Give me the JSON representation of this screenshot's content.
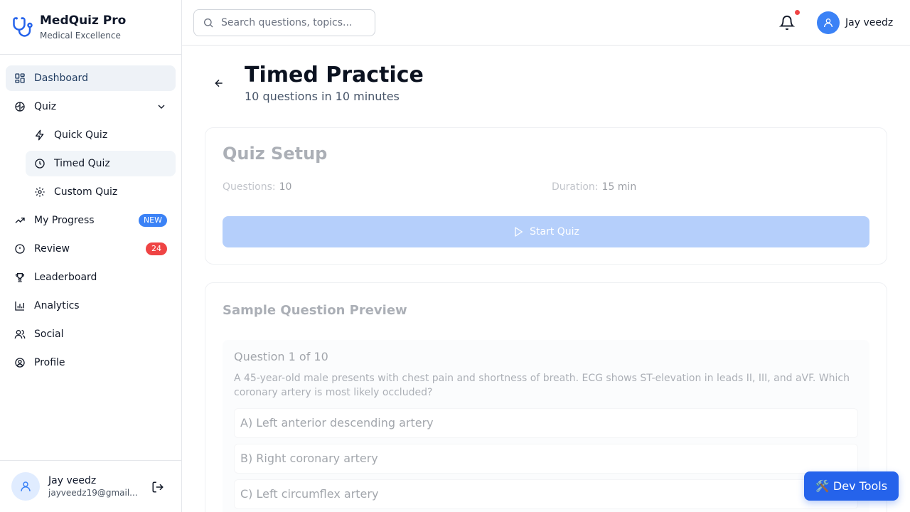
{
  "brand": {
    "title": "MedQuiz Pro",
    "subtitle": "Medical Excellence"
  },
  "sidebar": {
    "items": [
      {
        "label": "Dashboard",
        "icon": "dashboard-icon"
      },
      {
        "label": "Quiz",
        "icon": "brain-icon"
      },
      {
        "label": "Quick Quiz",
        "icon": "zap-icon"
      },
      {
        "label": "Timed Quiz",
        "icon": "clock-icon"
      },
      {
        "label": "Custom Quiz",
        "icon": "gear-icon"
      },
      {
        "label": "My Progress",
        "icon": "trending-up-icon",
        "badge": "NEW"
      },
      {
        "label": "Review",
        "icon": "alert-circle-icon",
        "badge": "24"
      },
      {
        "label": "Leaderboard",
        "icon": "trophy-icon"
      },
      {
        "label": "Analytics",
        "icon": "bar-chart-icon"
      },
      {
        "label": "Social",
        "icon": "users-icon"
      },
      {
        "label": "Profile",
        "icon": "user-circle-icon"
      }
    ]
  },
  "user": {
    "name": "Jay veedz",
    "email": "jayveedz19@gmail..."
  },
  "header": {
    "search_placeholder": "Search questions, topics...",
    "user_name": "Jay veedz"
  },
  "page": {
    "title": "Timed Practice",
    "subtitle": "10 questions in 10 minutes"
  },
  "setup": {
    "title": "Quiz Setup",
    "questions_label": "Questions:",
    "questions_value": "10",
    "duration_label": "Duration:",
    "duration_value": "15 min",
    "start_label": "Start Quiz"
  },
  "preview": {
    "title": "Sample Question Preview",
    "question_number": "Question 1 of 10",
    "question_text": "A 45-year-old male presents with chest pain and shortness of breath. ECG shows ST-elevation in leads II, III, and aVF. Which coronary artery is most likely occluded?",
    "options": [
      "A) Left anterior descending artery",
      "B) Right coronary artery",
      "C) Left circumflex artery"
    ]
  },
  "devtools": {
    "label": "🛠️ Dev Tools"
  },
  "colors": {
    "accent": "#3b82f6",
    "danger": "#ef4444",
    "devtools": "#2563eb"
  }
}
